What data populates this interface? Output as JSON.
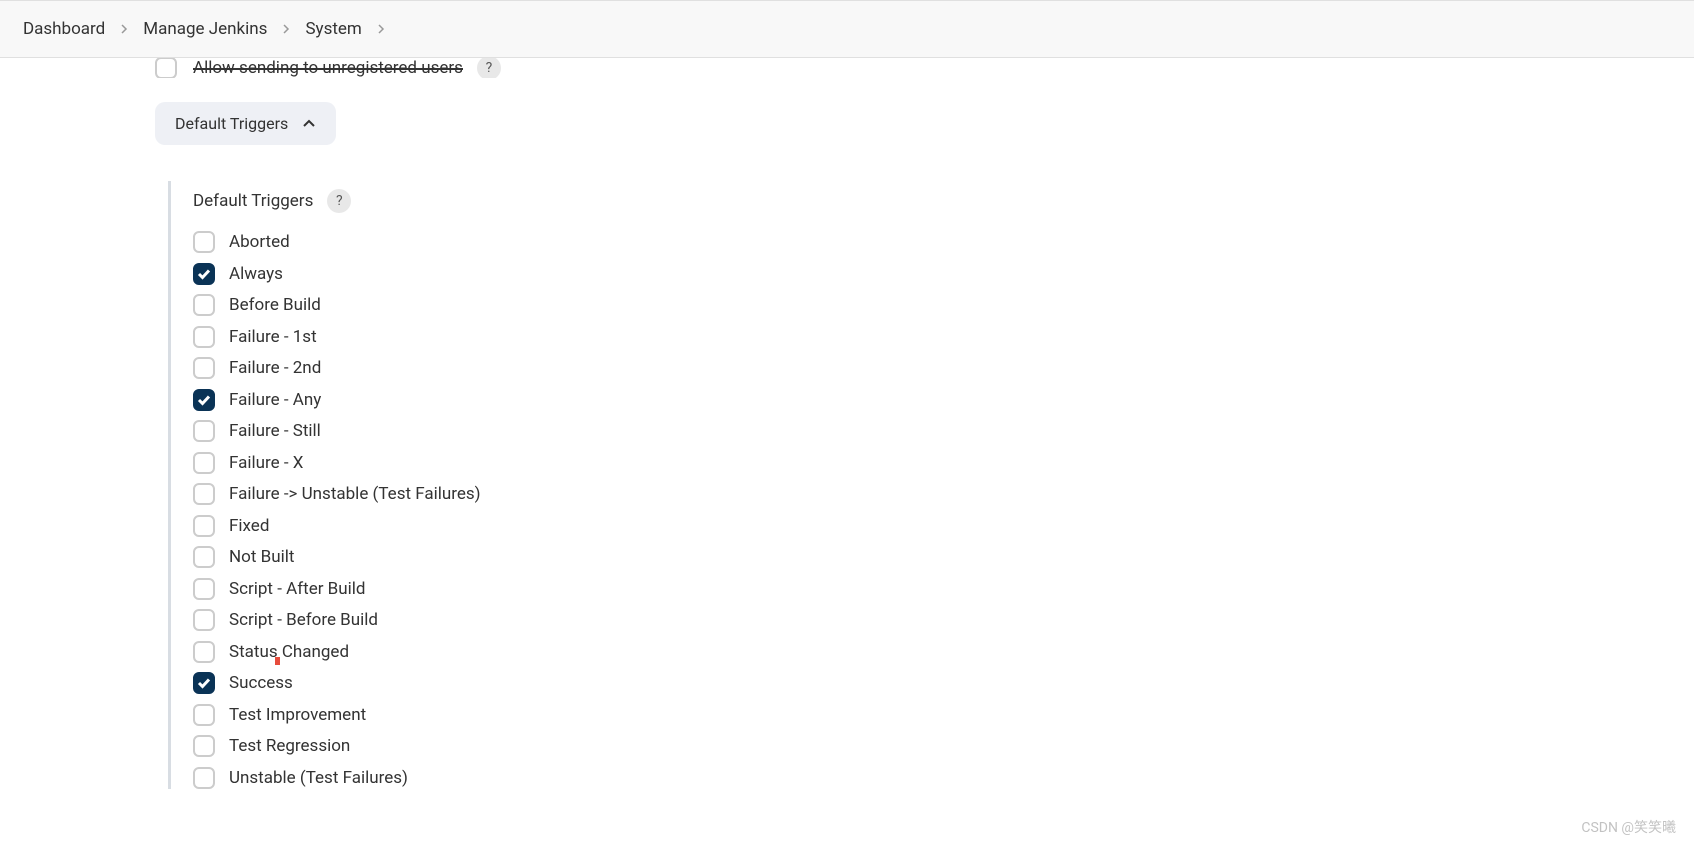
{
  "breadcrumb": {
    "items": [
      "Dashboard",
      "Manage Jenkins",
      "System"
    ]
  },
  "partial_row": {
    "label": "Allow sending to unregistered users"
  },
  "collapse": {
    "label": "Default Triggers"
  },
  "section": {
    "title": "Default Triggers",
    "help": "?",
    "triggers": [
      {
        "label": "Aborted",
        "checked": false
      },
      {
        "label": "Always",
        "checked": true
      },
      {
        "label": "Before Build",
        "checked": false
      },
      {
        "label": "Failure - 1st",
        "checked": false
      },
      {
        "label": "Failure - 2nd",
        "checked": false
      },
      {
        "label": "Failure - Any",
        "checked": true
      },
      {
        "label": "Failure - Still",
        "checked": false
      },
      {
        "label": "Failure - X",
        "checked": false
      },
      {
        "label": "Failure -> Unstable (Test Failures)",
        "checked": false
      },
      {
        "label": "Fixed",
        "checked": false
      },
      {
        "label": "Not Built",
        "checked": false
      },
      {
        "label": "Script - After Build",
        "checked": false
      },
      {
        "label": "Script - Before Build",
        "checked": false
      },
      {
        "label": "Status Changed",
        "checked": false
      },
      {
        "label": "Success",
        "checked": true
      },
      {
        "label": "Test Improvement",
        "checked": false
      },
      {
        "label": "Test Regression",
        "checked": false
      },
      {
        "label": "Unstable (Test Failures)",
        "checked": false
      }
    ]
  },
  "watermark": "CSDN @笑笑曦"
}
